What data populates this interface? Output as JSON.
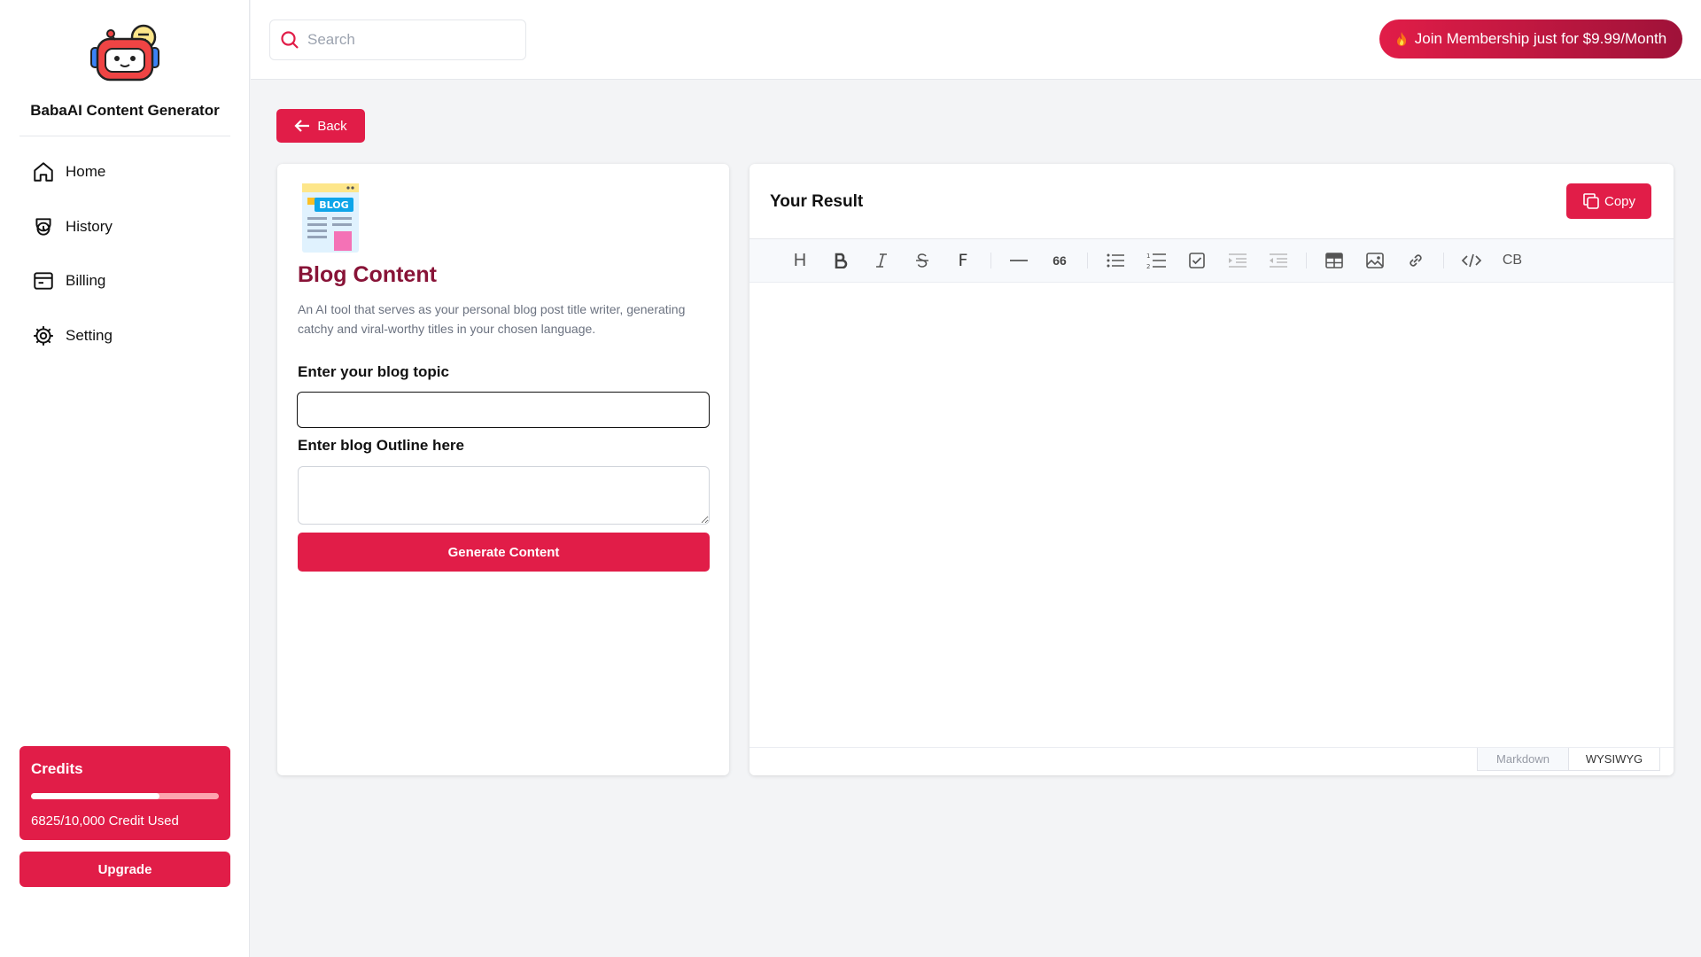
{
  "app": {
    "name": "BabaAI Content Generator"
  },
  "sidebar": {
    "items": [
      {
        "label": "Home",
        "icon": "home-icon"
      },
      {
        "label": "History",
        "icon": "history-icon"
      },
      {
        "label": "Billing",
        "icon": "billing-icon"
      },
      {
        "label": "Setting",
        "icon": "gear-icon"
      }
    ],
    "credits": {
      "title": "Credits",
      "used_text": "6825/10,000 Credit Used",
      "used_fraction": 0.6825
    },
    "upgrade_label": "Upgrade"
  },
  "header": {
    "search_placeholder": "Search",
    "membership_label": "Join Membership just for $9.99/Month"
  },
  "back_label": "Back",
  "form": {
    "title": "Blog Content",
    "icon_text": "BLOG",
    "description": "An AI tool that serves as your personal blog post title writer, generating catchy and viral-worthy titles in your chosen language.",
    "fields": [
      {
        "label": "Enter your blog topic",
        "value": ""
      },
      {
        "label": "Enter blog Outline here",
        "value": ""
      }
    ],
    "generate_label": "Generate Content"
  },
  "result": {
    "title": "Your Result",
    "copy_label": "Copy",
    "toolbar": {
      "heading": "H",
      "font": "F",
      "quote": "66",
      "codeblock": "CB"
    },
    "modes": [
      "Markdown",
      "WYSIWYG"
    ],
    "active_mode": "WYSIWYG"
  },
  "colors": {
    "accent": "#e11d48",
    "title": "#881337",
    "background": "#f3f4f6"
  }
}
